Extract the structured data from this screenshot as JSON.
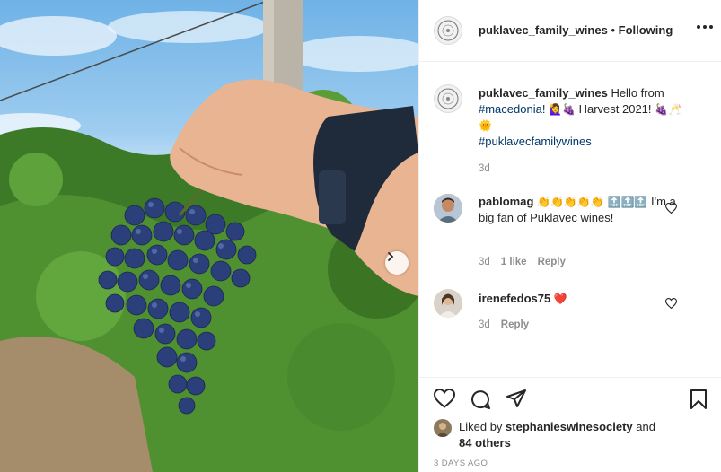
{
  "post": {
    "account": "puklavec_family_wines",
    "separator": "•",
    "follow_status": "Following",
    "caption": {
      "account": "puklavec_family_wines",
      "text_1": "Hello from",
      "tag_1": "#macedonia!",
      "emoji_1": "🙋‍♀️🍇",
      "text_2": "Harvest 2021!",
      "emoji_2": "🍇🥂🌞",
      "tag_2": "#puklavecfamilywines",
      "time": "3d"
    },
    "comments": [
      {
        "user": "pablomag",
        "emoji": "👏👏👏👏👏 🔝🔝🔝",
        "text": "I'm a big fan of Puklavec wines!",
        "time": "3d",
        "likes": "1 like",
        "reply": "Reply"
      },
      {
        "user": "irenefedos75",
        "emoji": "❤️",
        "time": "3d",
        "reply": "Reply"
      }
    ],
    "likes": {
      "prefix": "Liked by",
      "user": "stephanieswinesociety",
      "suffix": "and",
      "others": "84 others"
    },
    "date": "3 DAYS AGO"
  },
  "icons": {
    "more": "more-options-icon",
    "like": "heart-icon",
    "comment": "comment-icon",
    "share": "share-icon",
    "save": "bookmark-icon",
    "next": "chevron-right-icon"
  },
  "colors": {
    "text": "#262626",
    "muted": "#8e8e8e",
    "hashtag": "#00376b",
    "heart_red": "#ed4956",
    "border": "#efefef"
  }
}
